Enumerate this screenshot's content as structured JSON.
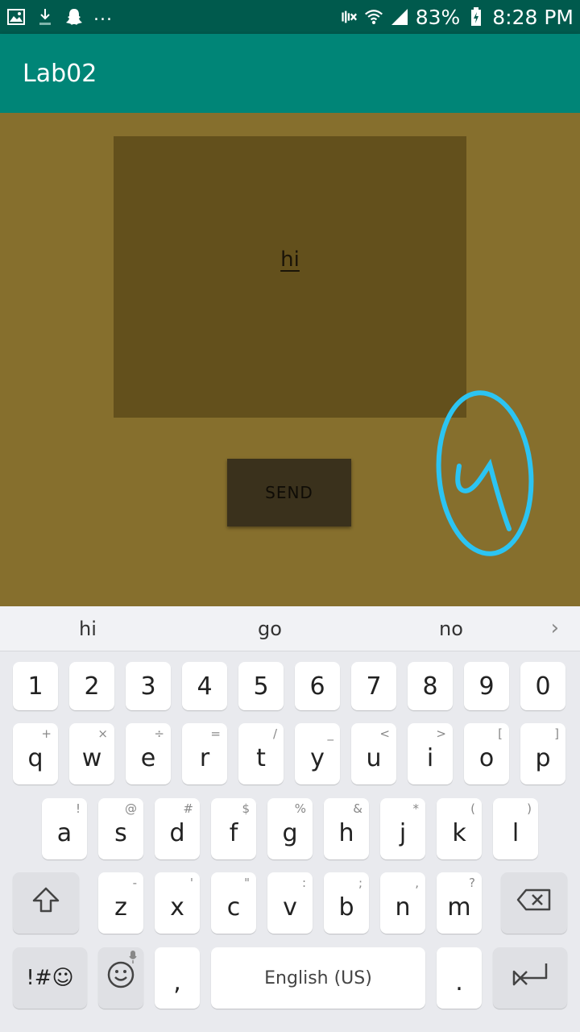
{
  "status_bar": {
    "battery": "83%",
    "time": "8:28 PM",
    "left_icons": [
      "image-icon",
      "download-icon",
      "snapchat-icon"
    ],
    "right_icons": [
      "mute-icon",
      "wifi-icon",
      "signal-icon",
      "battery-charging-icon"
    ],
    "more": "..."
  },
  "app_bar": {
    "title": "Lab02"
  },
  "message_box": {
    "text": "hi"
  },
  "send_button": {
    "label": "SEND"
  },
  "keyboard": {
    "suggestions": [
      "hi",
      "go",
      "no"
    ],
    "number_row": [
      "1",
      "2",
      "3",
      "4",
      "5",
      "6",
      "7",
      "8",
      "9",
      "0"
    ],
    "row1": [
      {
        "key": "q",
        "hint": "+"
      },
      {
        "key": "w",
        "hint": "×"
      },
      {
        "key": "e",
        "hint": "÷"
      },
      {
        "key": "r",
        "hint": "="
      },
      {
        "key": "t",
        "hint": "/"
      },
      {
        "key": "y",
        "hint": "_"
      },
      {
        "key": "u",
        "hint": "<"
      },
      {
        "key": "i",
        "hint": ">"
      },
      {
        "key": "o",
        "hint": "["
      },
      {
        "key": "p",
        "hint": "]"
      }
    ],
    "row2": [
      {
        "key": "a",
        "hint": "!"
      },
      {
        "key": "s",
        "hint": "@"
      },
      {
        "key": "d",
        "hint": "#"
      },
      {
        "key": "f",
        "hint": "$"
      },
      {
        "key": "g",
        "hint": "%"
      },
      {
        "key": "h",
        "hint": "&"
      },
      {
        "key": "j",
        "hint": "*"
      },
      {
        "key": "k",
        "hint": "("
      },
      {
        "key": "l",
        "hint": ")"
      }
    ],
    "row3": [
      {
        "key": "z",
        "hint": "-"
      },
      {
        "key": "x",
        "hint": "'"
      },
      {
        "key": "c",
        "hint": "\""
      },
      {
        "key": "v",
        "hint": ":"
      },
      {
        "key": "b",
        "hint": ";"
      },
      {
        "key": "n",
        "hint": ","
      },
      {
        "key": "m",
        "hint": "?"
      }
    ],
    "symbols_label": "!#☺",
    "comma": ",",
    "space_label": "English (US)",
    "period": "."
  }
}
